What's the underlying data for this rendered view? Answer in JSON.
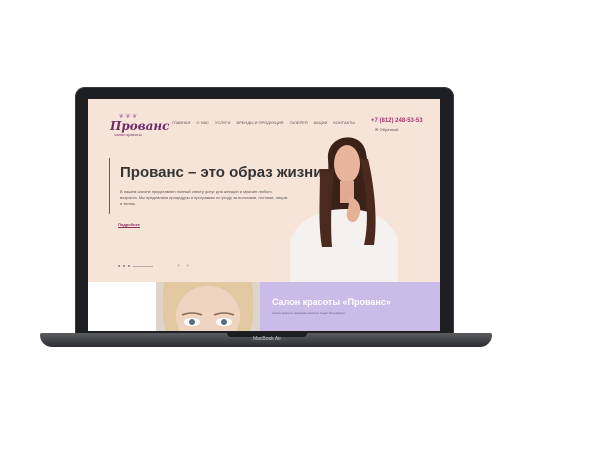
{
  "site": {
    "logo_main": "Прованс",
    "logo_sub": "салон красоты",
    "logo_ornament": "❦ ❦ ❦"
  },
  "nav": {
    "items": [
      "Главная",
      "О нас",
      "Услуги",
      "Бренды и продукция",
      "Галерея",
      "Акции",
      "Контакты"
    ]
  },
  "header": {
    "phone": "+7 (812) 248-53-53",
    "callback": "✉ Обратный"
  },
  "hero": {
    "title": "Прованс – это образ жизни",
    "text": "В нашем салоне представлен полный спектр услуг для женщин и мужчин любого возраста. Мы предлагаем процедуры и программы по уходу за волосами, ногтями, лицом и телом.",
    "more_link": "Подробнее",
    "slider_arrows": "‹ ›"
  },
  "lower": {
    "salon_title": "Салон красоты «Прованс»",
    "salon_sub": "Салон красоты премиум-класса в Санкт-Петербурге"
  },
  "device": {
    "model": "MacBook Air"
  },
  "colors": {
    "screen_bg": "#f6e4d8",
    "accent": "#9b3d7d",
    "lavender": "#cbbbe8"
  }
}
